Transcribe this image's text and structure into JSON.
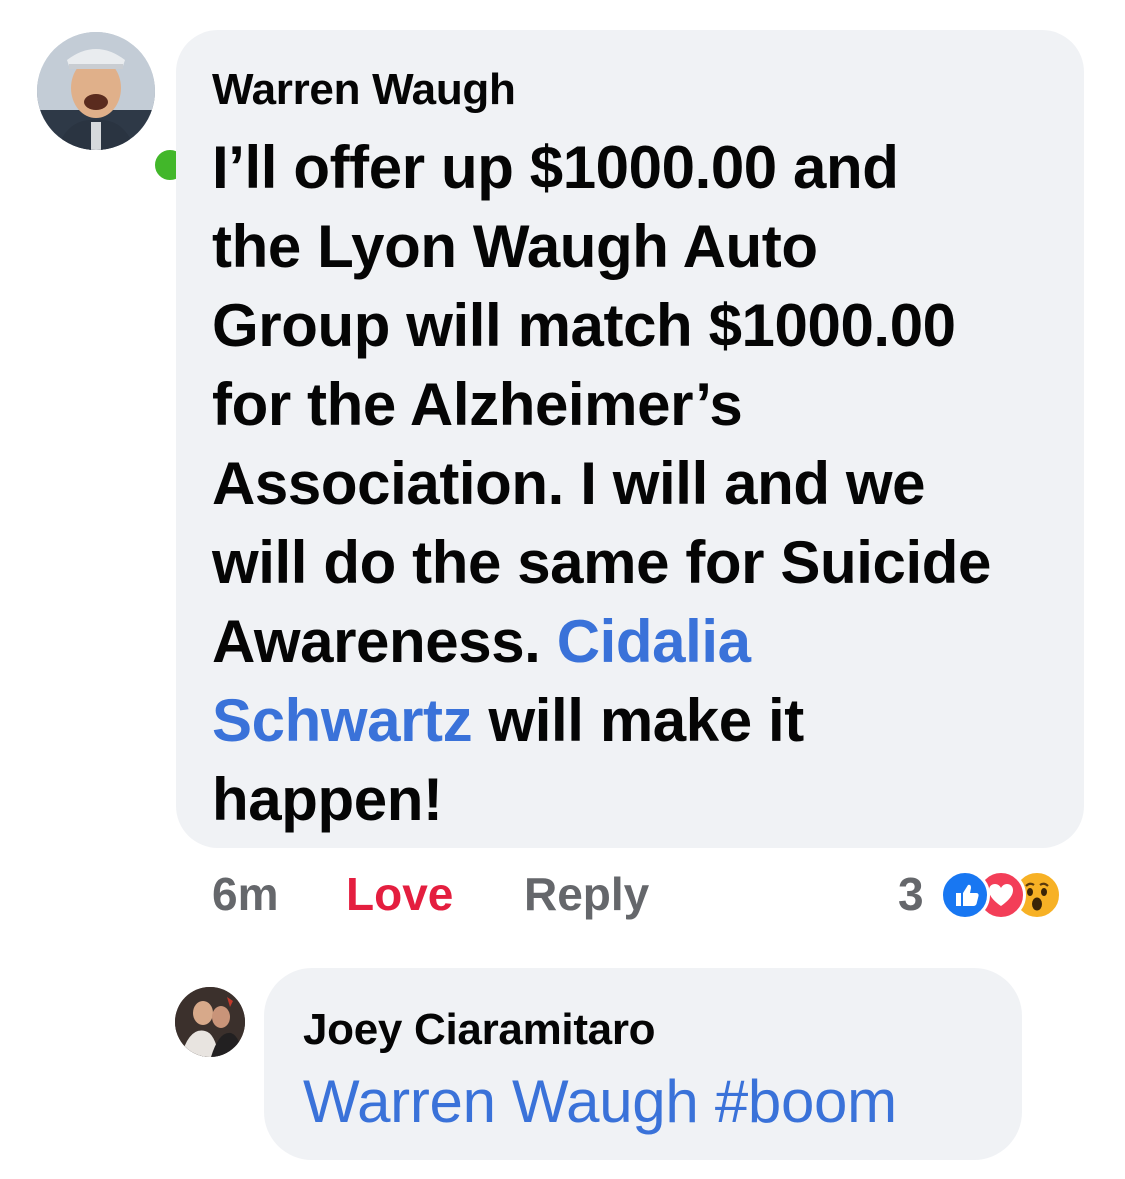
{
  "main_comment": {
    "author": "Warren Waugh",
    "lines": [
      "I’ll offer up $1000.00 and",
      "the Lyon Waugh Auto",
      "Group will match $1000.00",
      "for the Alzheimer’s",
      "Association. I will and we",
      "will do the same for Suicide",
      "Awareness."
    ],
    "mention_part1": "Cidalia",
    "mention_part2": "Schwartz",
    "line8_tail": " will make it",
    "line9": "happen!",
    "time": "6m",
    "love_label": "Love",
    "reply_label": "Reply",
    "reaction_count": "3",
    "reaction_icons": [
      "like-icon",
      "love-icon",
      "wow-icon"
    ],
    "online": true
  },
  "reply_comment": {
    "author": "Joey Ciaramitaro",
    "mention": "Warren Waugh",
    "hashtag": "#boom"
  },
  "colors": {
    "bubble": "#f0f2f5",
    "mention": "#3a72d9",
    "love": "#e41e3f",
    "meta": "#65676b",
    "online": "#42b72a",
    "like": "#1877f2",
    "heart": "#f33e58",
    "wow": "#f7b125"
  }
}
